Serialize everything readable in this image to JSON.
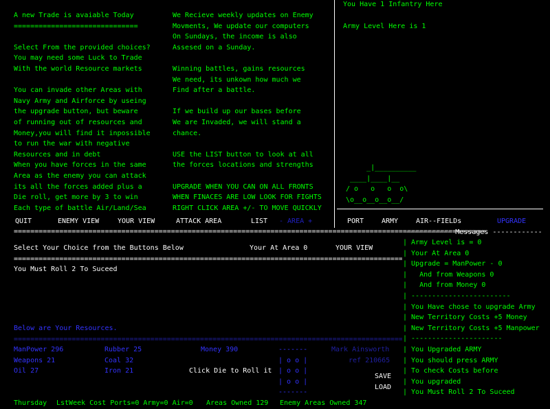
{
  "left_col": [
    "A new Trade is avaiable Today",
    "==============================",
    "",
    "Select From the provided choices?",
    "You may need some Luck to Trade",
    "With the world Resource markets",
    "",
    "You can invade other Areas with",
    "Navy Army and Airforce by useing",
    "the upgrade button, but beware",
    "of running out of resources and",
    "Money,you will find it inpossible",
    "to run the war with negative",
    "Resources and in debt",
    "When you have forces in the same",
    "Area as the enemy you can attack",
    "its all the forces added plus a",
    "Die roll, get more by 3 to win",
    "Each type of battle Air/Land/Sea"
  ],
  "mid_col": [
    "We Recieve weekly updates on Enemy",
    "Movments, We update our computers",
    "On Sundays, the income is also",
    "Assesed on a Sunday.",
    "",
    "Winning battles, gains resources",
    "We need, its unkown how much we",
    "Find after a battle.",
    "",
    "If we build up our bases before",
    "We are Invaded, we will stand a",
    "chance.",
    "",
    "USE the LIST button to look at all",
    "the forces locations and strengths",
    "",
    "UPGRADE WHEN YOU CAN ON ALL FRONTS",
    "WHEN FINACES ARE LOW LOOK FOR FIGHTS",
    "RIGHT CLICK AREA +/- TO MOVE QUICKLY"
  ],
  "right_panel": {
    "infantry": "You Have 1 Infantry Here",
    "army_level": "Army Level Here is 1",
    "ship_art": [
      "      _|__________",
      "  ____|____|__",
      " / o   o   o  o\\",
      " \\o__o__o__o__/"
    ]
  },
  "menu": {
    "quit": "QUIT",
    "enemy_view": "ENEMY VIEW",
    "your_view": "YOUR VIEW",
    "attack_area": "ATTACK AREA",
    "list": "LIST",
    "area": "- AREA +",
    "port": "PORT",
    "army": "ARMY",
    "airfields": "AIR--FIELDs",
    "upgrade": "UPGRADE"
  },
  "rule_long": "==================================================================================================================",
  "status": {
    "select": "Select Your Choice from the Buttons Below",
    "at_area": "Your At Area 0",
    "view": "YOUR VIEW",
    "roll": "You Must Roll 2 To Suceed"
  },
  "messages": {
    "header": "----------- Messages ------------",
    "lines": [
      "| Army Level is = 0",
      "| Your At Area 0",
      "| Upgrade = ManPower - 0",
      "|   And from Weapons 0",
      "|   And from Money 0",
      "| ------------------------",
      "| You Have chose to upgrade Army",
      "| New Territory Costs +5 Money",
      "| New Territory Costs +5 Manpower",
      "| ----------------------",
      "| You Upgraded ARMY",
      "| You should press ARMY",
      "| To check Costs before",
      "| You upgraded",
      "| You Must Roll 2 To Suceed"
    ]
  },
  "resources": {
    "heading": "Below are Your Resources.",
    "rule": "==========================================================================================================",
    "manpower": "ManPower 296",
    "weapons": "Weapons 21",
    "oil": "Oil 27",
    "rubber": "Rubber 25",
    "coal": "Coal 32",
    "iron": "Iron 21",
    "money": "Money 390",
    "die_prompt": "Click Die to Roll it",
    "die_top": "-------",
    "die_rows": [
      "| o o |",
      "| o o |",
      "| o o |"
    ],
    "die_bottom": "-------",
    "author": "Mark Ainsworth",
    "ref": "ref 210665",
    "save": "SAVE",
    "load": "LOAD"
  },
  "footer": {
    "day": "Thursday",
    "lastweek": "LstWeek Cost Ports=0 Army=0 Air=0",
    "owned": "Areas Owned 129",
    "enemy": "Enemy Areas Owned 347"
  }
}
